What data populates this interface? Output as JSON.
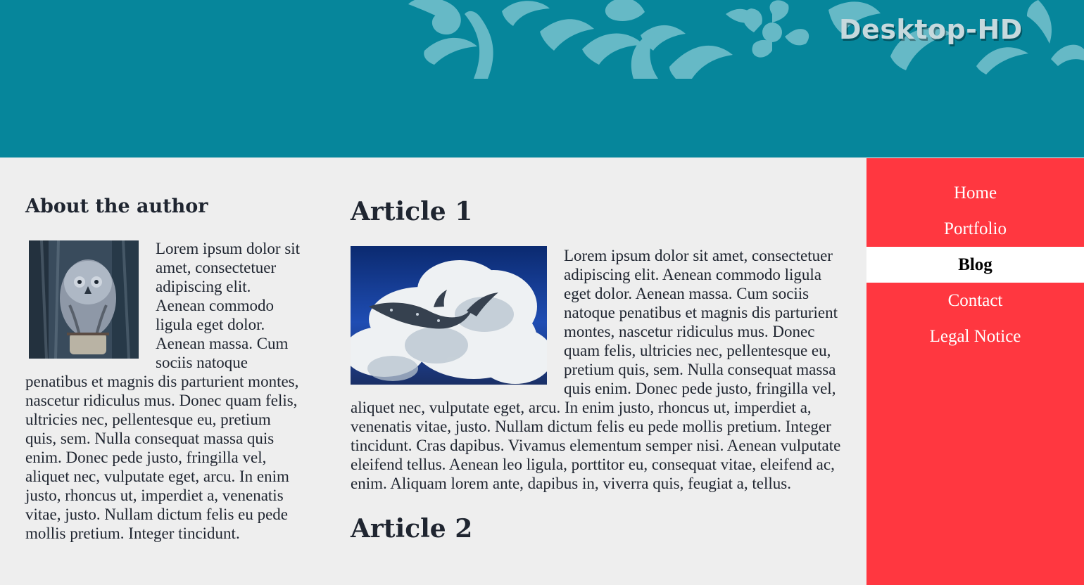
{
  "header": {
    "brand_title": "Desktop-HD",
    "background_color": "#06869b",
    "ornament_icon": "floral-ornament-icon"
  },
  "sidebar_author": {
    "title": "About the author",
    "photo_icon": "owl-photo",
    "text": "Lorem ipsum dolor sit amet, consectetuer adipiscing elit. Aenean commodo ligula eget dolor. Aenean massa. Cum sociis natoque penatibus et magnis dis parturient montes, nascetur ridiculus mus. Donec quam felis, ultricies nec, pellentesque eu, pretium quis, sem. Nulla consequat massa quis enim. Donec pede justo, fringilla vel, aliquet nec, vulputate eget, arcu. In enim justo, rhoncus ut, imperdiet a, venenatis vitae, justo. Nullam dictum felis eu pede mollis pretium. Integer tincidunt."
  },
  "main": {
    "articles": [
      {
        "title": "Article 1",
        "photo_icon": "whale-in-clouds-photo",
        "text": "Lorem ipsum dolor sit amet, consectetuer adipiscing elit. Aenean commodo ligula eget dolor. Aenean massa. Cum sociis natoque penatibus et magnis dis parturient montes, nascetur ridiculus mus. Donec quam felis, ultricies nec, pellentesque eu, pretium quis, sem. Nulla consequat massa quis enim. Donec pede justo, fringilla vel, aliquet nec, vulputate eget, arcu. In enim justo, rhoncus ut, imperdiet a, venenatis vitae, justo. Nullam dictum felis eu pede mollis pretium. Integer tincidunt. Cras dapibus. Vivamus elementum semper nisi. Aenean vulputate eleifend tellus. Aenean leo ligula, porttitor eu, consequat vitae, eleifend ac, enim. Aliquam lorem ante, dapibus in, viverra quis, feugiat a, tellus."
      },
      {
        "title": "Article 2"
      }
    ]
  },
  "nav": {
    "background_color": "#ff3740",
    "active_index": 2,
    "items": [
      {
        "label": "Home"
      },
      {
        "label": "Portfolio"
      },
      {
        "label": "Blog"
      },
      {
        "label": "Contact"
      },
      {
        "label": "Legal Notice"
      }
    ]
  }
}
